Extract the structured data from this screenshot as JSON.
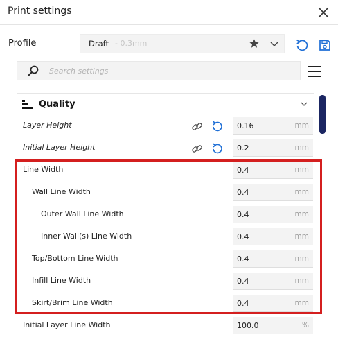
{
  "window": {
    "title": "Print settings"
  },
  "profile": {
    "label": "Profile",
    "name": "Draft",
    "detail": " - 0.3mm"
  },
  "search": {
    "placeholder": "Search settings"
  },
  "category": {
    "label": "Quality"
  },
  "settings": [
    {
      "label": "Layer Height",
      "value": "0.16",
      "unit": "mm"
    },
    {
      "label": "Initial Layer Height",
      "value": "0.2",
      "unit": "mm"
    },
    {
      "label": "Line Width",
      "value": "0.4",
      "unit": "mm"
    },
    {
      "label": "Wall Line Width",
      "value": "0.4",
      "unit": "mm"
    },
    {
      "label": "Outer Wall Line Width",
      "value": "0.4",
      "unit": "mm"
    },
    {
      "label": "Inner Wall(s) Line Width",
      "value": "0.4",
      "unit": "mm"
    },
    {
      "label": "Top/Bottom Line Width",
      "value": "0.4",
      "unit": "mm"
    },
    {
      "label": "Infill Line Width",
      "value": "0.4",
      "unit": "mm"
    },
    {
      "label": "Skirt/Brim Line Width",
      "value": "0.4",
      "unit": "mm"
    },
    {
      "label": "Initial Layer Line Width",
      "value": "100.0",
      "unit": "%"
    }
  ],
  "colors": {
    "accent": "#1f6fd6",
    "highlight": "#d41f1f",
    "scrollbar": "#1b2662"
  },
  "icons": [
    "close-icon",
    "star-icon",
    "chevron-down-icon",
    "reset-icon",
    "save-icon",
    "search-icon",
    "hamburger-menu-icon",
    "quality-icon",
    "link-icon"
  ]
}
